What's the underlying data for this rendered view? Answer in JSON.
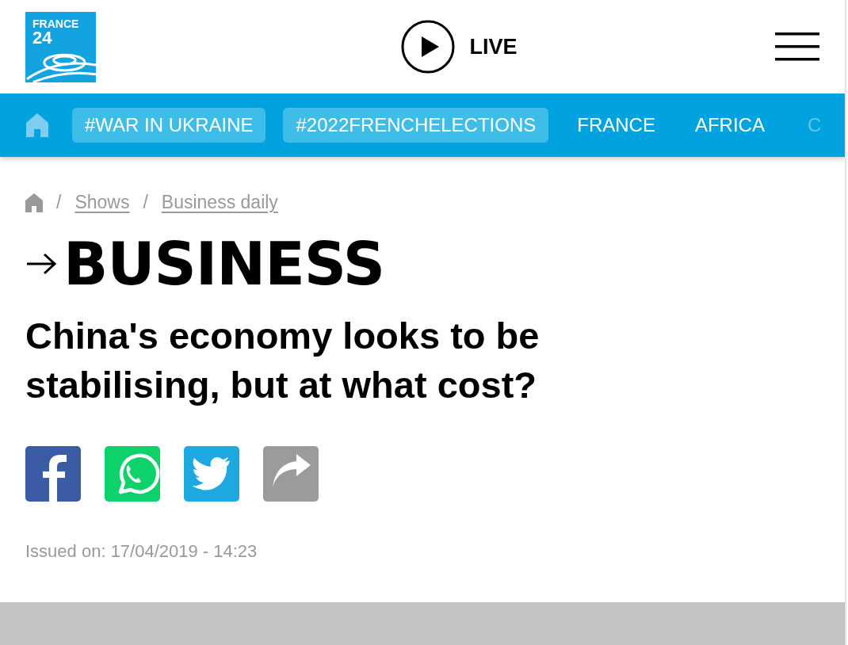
{
  "header": {
    "logo": {
      "line_1": "FRANCE",
      "line_2": "24"
    },
    "live_label": "LIVE"
  },
  "nav": {
    "items": [
      {
        "label": "#WAR IN UKRAINE",
        "kind": "tag"
      },
      {
        "label": "#2022FRENCHELECTIONS",
        "kind": "tag"
      },
      {
        "label": "FRANCE",
        "kind": "plain"
      },
      {
        "label": "AFRICA",
        "kind": "plain"
      },
      {
        "label": "C",
        "kind": "faded"
      }
    ]
  },
  "breadcrumb": [
    {
      "separator": "/",
      "label": "Shows"
    },
    {
      "separator": "/",
      "label": "Business daily"
    }
  ],
  "section": "BUSINESS",
  "headline": "China's economy looks to be stabilising, but at what cost?",
  "share": [
    {
      "kind": "facebook"
    },
    {
      "kind": "whatsapp"
    },
    {
      "kind": "twitter"
    },
    {
      "kind": "share"
    }
  ],
  "issued": "Issued on: 17/04/2019 - 14:23"
}
